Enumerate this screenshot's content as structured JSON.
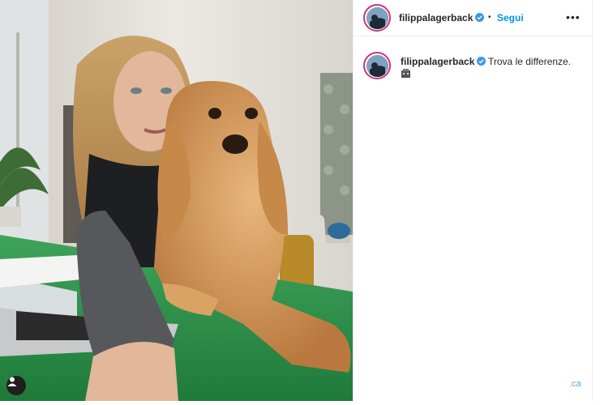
{
  "post": {
    "author": {
      "username": "filippalagerback",
      "verified": true,
      "avatar_icon": "profile-avatar"
    },
    "header": {
      "separator": "•",
      "follow_label": "Segui",
      "more_icon": "more-options-icon",
      "more_label": "•••"
    },
    "caption": {
      "username": "filippalagerback",
      "text": "Trova le differenze."
    },
    "photo": {
      "tag_icon": "user-tag-icon"
    },
    "watermark": ".ca"
  },
  "colors": {
    "link_blue": "#0095f6",
    "verified_blue": "#3897f0",
    "text": "#262626",
    "ring": "#c9357a"
  }
}
